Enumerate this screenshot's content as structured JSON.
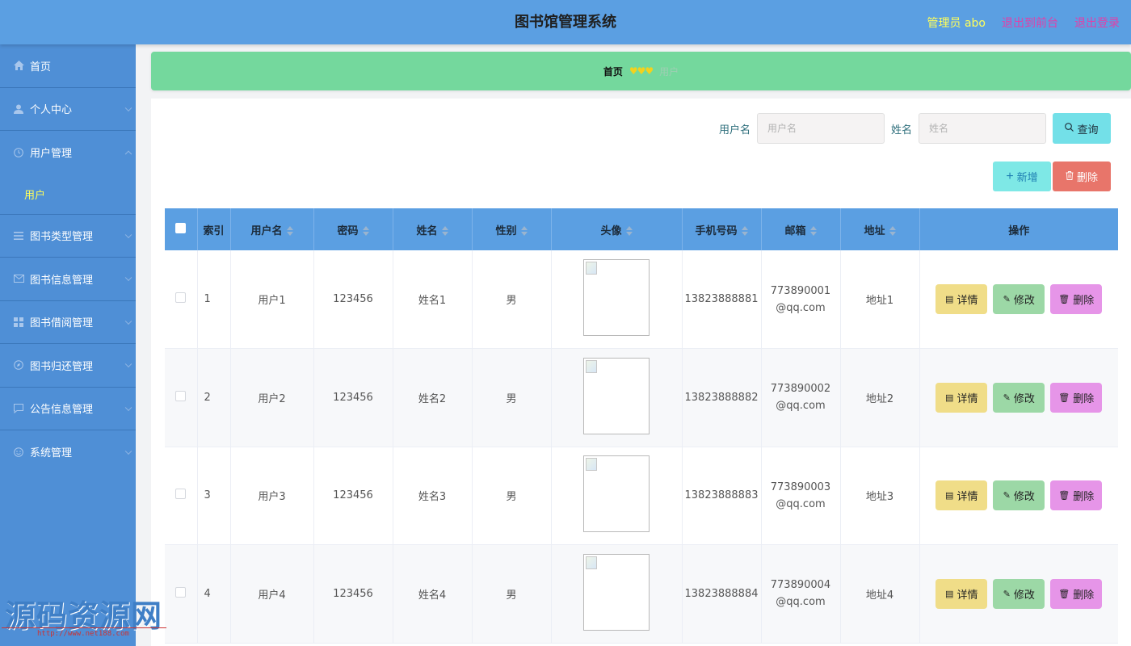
{
  "header": {
    "title": "图书馆管理系统",
    "admin_label": "管理员 abo",
    "to_front": "退出到前台",
    "logout": "退出登录"
  },
  "sidebar": {
    "items": [
      {
        "label": "首页",
        "icon": "home-icon",
        "expandable": false
      },
      {
        "label": "个人中心",
        "icon": "user-icon",
        "expandable": true
      },
      {
        "label": "用户管理",
        "icon": "clock-icon",
        "expandable": true,
        "children": [
          "用户"
        ]
      },
      {
        "label": "图书类型管理",
        "icon": "list-icon",
        "expandable": true
      },
      {
        "label": "图书信息管理",
        "icon": "mail-icon",
        "expandable": true
      },
      {
        "label": "图书借阅管理",
        "icon": "grid-icon",
        "expandable": true
      },
      {
        "label": "图书归还管理",
        "icon": "compass-icon",
        "expandable": true
      },
      {
        "label": "公告信息管理",
        "icon": "chat-icon",
        "expandable": true
      },
      {
        "label": "系统管理",
        "icon": "smile-icon",
        "expandable": true
      }
    ]
  },
  "breadcrumb": {
    "home": "首页",
    "hearts": "♥♥♥",
    "current": "用户"
  },
  "search": {
    "username_label": "用户名",
    "username_placeholder": "用户名",
    "name_label": "姓名",
    "name_placeholder": "姓名",
    "query_button": "查询"
  },
  "actions": {
    "add": "新增",
    "delete": "删除"
  },
  "table": {
    "columns": [
      "索引",
      "用户名",
      "密码",
      "姓名",
      "性别",
      "头像",
      "手机号码",
      "邮箱",
      "地址",
      "操作"
    ],
    "rows": [
      {
        "index": "1",
        "username": "用户1",
        "password": "123456",
        "name": "姓名1",
        "gender": "男",
        "phone": "13823888881",
        "email": "773890001@qq.com",
        "address": "地址1"
      },
      {
        "index": "2",
        "username": "用户2",
        "password": "123456",
        "name": "姓名2",
        "gender": "男",
        "phone": "13823888882",
        "email": "773890002@qq.com",
        "address": "地址2"
      },
      {
        "index": "3",
        "username": "用户3",
        "password": "123456",
        "name": "姓名3",
        "gender": "男",
        "phone": "13823888883",
        "email": "773890003@qq.com",
        "address": "地址3"
      },
      {
        "index": "4",
        "username": "用户4",
        "password": "123456",
        "name": "姓名4",
        "gender": "男",
        "phone": "13823888884",
        "email": "773890004@qq.com",
        "address": "地址4"
      }
    ],
    "row_actions": {
      "detail": "详情",
      "edit": "修改",
      "delete": "删除"
    }
  },
  "watermark": {
    "text": "源码资源网",
    "url": "http://www.net188.com"
  },
  "colors": {
    "header": "#5b9fe2",
    "sidebar": "#4f8fd6",
    "breadcrumb": "#74d89d",
    "accent_yellow": "#ffff5a",
    "link_pink": "#e23fa8"
  }
}
